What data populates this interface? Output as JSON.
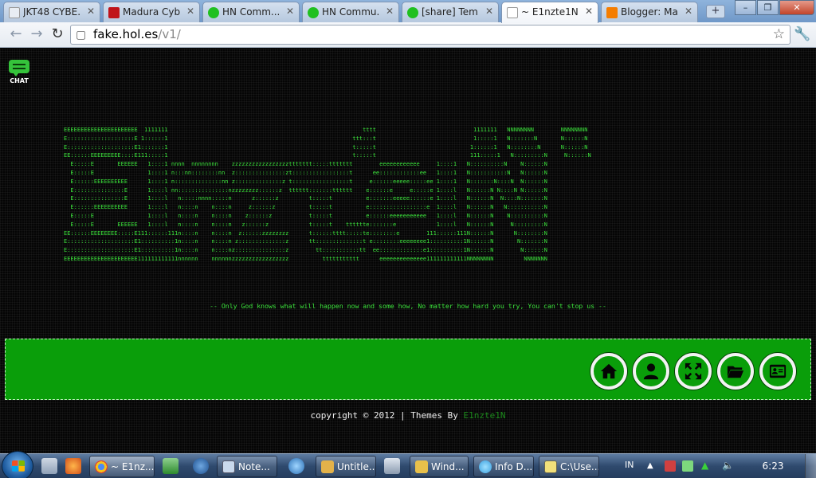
{
  "browser": {
    "tabs": [
      {
        "label": "JKT48 CYBE...",
        "icon": "document-icon",
        "color": "#e8edf3"
      },
      {
        "label": "Madura Cyb...",
        "icon": "madura-logo-icon",
        "color": "#c0141a"
      },
      {
        "label": "HN Comm...",
        "icon": "green-skull-icon",
        "color": "#20c020"
      },
      {
        "label": "HN Commu...",
        "icon": "green-skull-icon",
        "color": "#20c020"
      },
      {
        "label": "[share] Tem...",
        "icon": "green-skull-icon",
        "color": "#20c020"
      },
      {
        "label": "~ E1nzte1N ...",
        "icon": "document-icon",
        "color": "#ffffff",
        "active": true
      },
      {
        "label": "Blogger: Ma...",
        "icon": "blogger-icon",
        "color": "#f57d00"
      }
    ],
    "url_host": "fake.hol.es",
    "url_path": "/v1/"
  },
  "page": {
    "chat_label": "CHAT",
    "ascii_art": [
      "EEEEEEEEEEEEEEEEEEEEEE  1111111                                                          tttt                             1111111   NNNNNNNN        NNNNNNNN",
      "E::::::::::::::::::::E 1::::::1                                                       ttt:::t                             1:::::1   N:::::::N       N::::::N",
      "E::::::::::::::::::::E1:::::::1                                                       t:::::t                            1::::::1   N::::::::N      N::::::N",
      "EE::::::EEEEEEEEE::::E111:::::1                                                       t:::::t                            111:::::1   N:::::::::N     N::::::N",
      "  E:::::E       EEEEEE   1::::1 nnnn  nnnnnnnn    zzzzzzzzzzzzzzzzzttttttt:::::ttttttt        eeeeeeeeeeee     1::::1   N::::::::::N    N::::::N",
      "  E:::::E                1::::1 n:::nn::::::::nn  z:::::::::::::::zt:::::::::::::::::t      ee::::::::::::ee   1::::1   N:::::::::::N   N::::::N",
      "  E::::::EEEEEEEEEE      1::::1 n::::::::::::::nn z::::::::::::::z t:::::::::::::::::t     e::::::eeeee:::::ee 1::::1   N:::::::N::::N  N::::::N",
      "  E:::::::::::::::E      1::::l nn:::::::::::::::nzzzzzzzz::::::z  tttttt:::::::tttttt    e::::::e     e:::::e 1::::l   N::::::N N::::N N::::::N",
      "  E:::::::::::::::E      1::::l   n:::::nnnn:::::n      z::::::z         t:::::t          e:::::::eeeee::::::e 1::::l   N::::::N  N::::N:::::::N",
      "  E::::::EEEEEEEEEE      1::::l   n::::n    n::::n     z::::::z          t:::::t          e:::::::::::::::::e  1::::l   N::::::N   N:::::::::::N",
      "  E:::::E                1::::l   n::::n    n::::n    z::::::z           t:::::t          e::::::eeeeeeeeeee   1::::l   N::::::N    N::::::::::N",
      "  E:::::E       EEEEEE   1::::l   n::::n    n::::n   z::::::z            t:::::t    tttttte:::::::e            1::::l   N::::::N     N:::::::::N",
      "EE::::::EEEEEEEE:::::E111::::::111n::::n    n::::n  z::::::zzzzzzzz      t::::::tttt:::::te::::::::e        111::::::111N::::::N      N::::::::N",
      "E::::::::::::::::::::E1::::::::::1n::::n    n::::n z::::::::::::::z      tt::::::::::::::t e::::::::eeeeeeee1::::::::::1N::::::N       N:::::::N",
      "E::::::::::::::::::::E1::::::::::1n::::n    n::::nz:::::::::::::::z        tt:::::::::::tt  ee:::::::::::::e1::::::::::1N::::::N        N::::::N",
      "EEEEEEEEEEEEEEEEEEEEEE111111111111nnnnnn    nnnnnnzzzzzzzzzzzzzzzzz          ttttttttttt      eeeeeeeeeeeeee111111111111NNNNNNNN         NNNNNNN"
    ],
    "motto": "-- Only God knows what will happen now and some how, No matter how hard you try, You can't stop us --",
    "nav_buttons": [
      {
        "name": "home-button",
        "icon": "home-icon"
      },
      {
        "name": "profile-button",
        "icon": "user-icon"
      },
      {
        "name": "fullscreen-button",
        "icon": "expand-icon"
      },
      {
        "name": "folder-button",
        "icon": "folder-icon"
      },
      {
        "name": "contact-button",
        "icon": "contact-card-icon"
      }
    ],
    "footer_text": "copyright © 2012 | Themes By ",
    "footer_author": "E1nzte1N",
    "accent_color": "#0a9e0a",
    "text_color": "#3be23b"
  },
  "taskbar": {
    "tasks": [
      {
        "label": "~ E1nz...",
        "icon": "chrome-icon",
        "color": "#4c8bf5",
        "active": true
      },
      {
        "label": "Note...",
        "icon": "notepad-icon",
        "color": "#c9d9ec"
      },
      {
        "label": "Untitle...",
        "icon": "paint-icon",
        "color": "#e3b24a"
      },
      {
        "label": "Wind...",
        "icon": "folder-icon",
        "color": "#e8c04a"
      },
      {
        "label": "Info D...",
        "icon": "globe-icon",
        "color": "#3aa0e0"
      },
      {
        "label": "C:\\Use...",
        "icon": "notepad-icon",
        "color": "#f2e07a"
      }
    ],
    "language": "IN",
    "clock": "6:23"
  }
}
